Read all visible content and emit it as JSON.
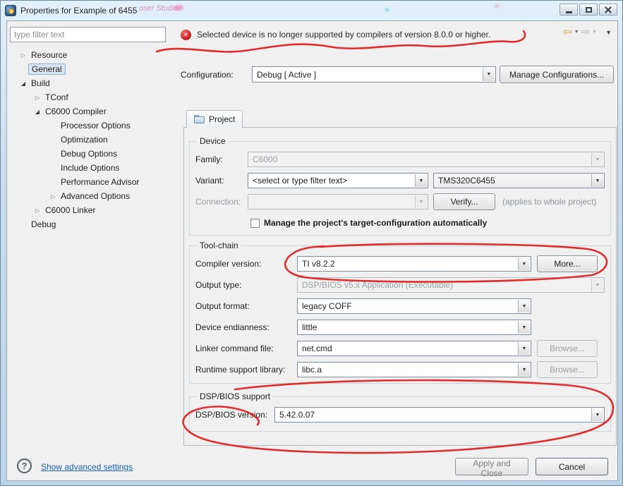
{
  "icons": {
    "collapsed_arrow": "▷",
    "expanded_arrow": "◢",
    "dropdown_arrow": "▼",
    "back_arrow": "⇦",
    "forward_arrow": "⇨",
    "menu_arrow": "▼",
    "error_x": "✕",
    "help_q": "?"
  },
  "window": {
    "title": "Properties for Example of 6455",
    "glass_text": "oser Studio"
  },
  "sidebar": {
    "filter_placeholder": "type filter text",
    "tree": [
      {
        "label": "Resource"
      },
      {
        "label": "General"
      },
      {
        "label": "Build"
      },
      {
        "label": "TConf"
      },
      {
        "label": "C6000 Compiler"
      },
      {
        "label": "Processor Options"
      },
      {
        "label": "Optimization"
      },
      {
        "label": "Debug Options"
      },
      {
        "label": "Include Options"
      },
      {
        "label": "Performance Advisor"
      },
      {
        "label": "Advanced Options"
      },
      {
        "label": "C6000 Linker"
      },
      {
        "label": "Debug"
      }
    ]
  },
  "error_banner": {
    "message": "Selected device is no longer supported by compilers of version 8.0.0 or higher."
  },
  "configuration": {
    "label": "Configuration:",
    "value": "Debug  [ Active ]",
    "manage_button": "Manage Configurations..."
  },
  "tab": {
    "label": "Project"
  },
  "device": {
    "legend": "Device",
    "family_label": "Family:",
    "family_value": "C6000",
    "variant_label": "Variant:",
    "variant_placeholder": "<select or type filter text>",
    "variant_value": "TMS320C6455",
    "connection_label": "Connection:",
    "verify_button": "Verify...",
    "applies_note": "(applies to whole project)",
    "manage_checkbox_label": "Manage the project's target-configuration automatically"
  },
  "toolchain": {
    "legend": "Tool-chain",
    "rows": [
      {
        "label": "Compiler version:",
        "value": "TI v8.2.2",
        "button": "More..."
      },
      {
        "label": "Output type:",
        "value": "DSP/BIOS v5.x Application (Executable)"
      },
      {
        "label": "Output format:",
        "value": "legacy COFF"
      },
      {
        "label": "Device endianness:",
        "value": "little"
      },
      {
        "label": "Linker command file:",
        "value": "net.cmd",
        "button": "Browse..."
      },
      {
        "label": "Runtime support library:",
        "value": "libc.a",
        "button": "Browse..."
      }
    ]
  },
  "bios": {
    "legend": "DSP/BIOS support",
    "version_label": "DSP/BIOS version:",
    "version_value": "5.42.0.07"
  },
  "footer": {
    "advanced_link": "Show advanced settings",
    "apply_button": "Apply and Close",
    "cancel_button": "Cancel"
  }
}
